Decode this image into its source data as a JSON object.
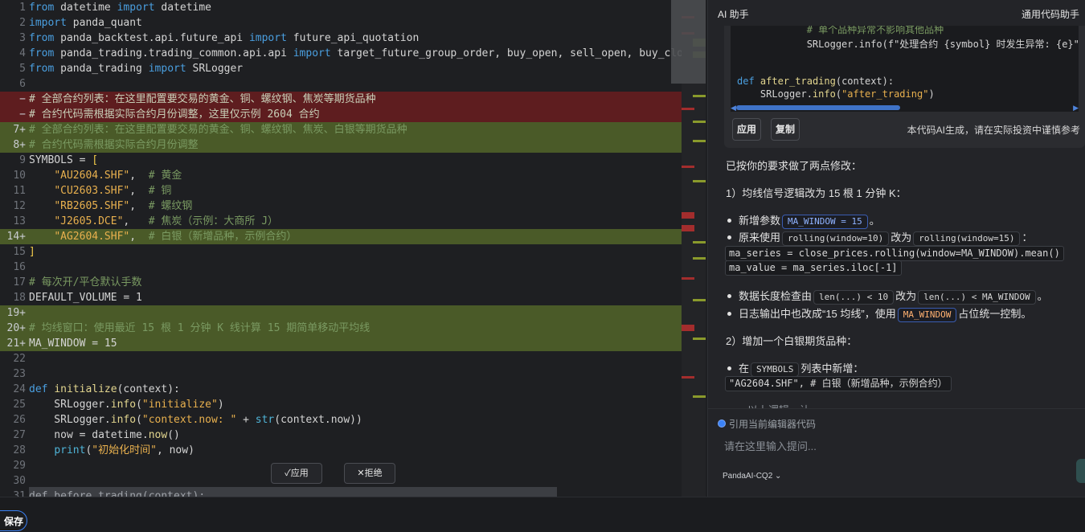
{
  "editor": {
    "apply_label": "✓应用",
    "reject_label": "✕拒绝",
    "folded_text": "def before_trading(context):"
  },
  "bottom": {
    "save_label": "保存"
  },
  "ai": {
    "title": "AI 助手",
    "header_right": "通用代码助手",
    "code_lines": [
      "            # 单个品种异常不影响其他品种",
      "            SRLogger.info(f\"处理合约 {symbol} 时发生异常: {e}\")",
      "",
      "",
      "def after_trading(context):",
      "    SRLogger.info(\"after_trading\")"
    ],
    "apply_label": "应用",
    "copy_label": "复制",
    "disclaimer": "本代码AI生成，请在实际投资中谨慎参考",
    "intro": "已按你的要求做了两点修改：",
    "section1": "1）均线信号逻辑改为 15 根 1 分钟 K：",
    "b1_pre": "新增参数",
    "b1_chip": "MA_WINDOW = 15",
    "b1_post": "。",
    "b2_pre": "原来使用",
    "b2_chip1": "rolling(window=10)",
    "b2_mid": "改为",
    "b2_chip2": "rolling(window=15)",
    "b2_post": "：",
    "code_a": "ma_series = close_prices.rolling(window=MA_WINDOW).mean()",
    "code_b": "ma_value = ma_series.iloc[-1]",
    "b3_pre": "数据长度检查由",
    "b3_chip1": "len(...) < 10",
    "b3_mid": "改为",
    "b3_chip2": "len(...) < MA_WINDOW",
    "b3_post": "。",
    "b4_pre": "日志输出中也改成“15 均线”，使用",
    "b4_chip": "MA_WINDOW",
    "b4_post": "占位统一控制。",
    "section2": "2）增加一个白银期货品种：",
    "b5_pre": "在",
    "b5_chip": "SYMBOLS",
    "b5_post": "列表中新增：",
    "code_c": "\"AG2604.SHF\",  # 白银（新增品种，示例合约）",
    "cut_line": "...以上逻辑，让...",
    "quote_label": "引用当前编辑器代码",
    "input_placeholder": "请在这里输入提问...",
    "model": "PandaAI-CQ2 ⌄"
  },
  "colors": {
    "accent": "#3b82f6",
    "deleted": "#5e1d1f",
    "added": "#4a5a28"
  }
}
